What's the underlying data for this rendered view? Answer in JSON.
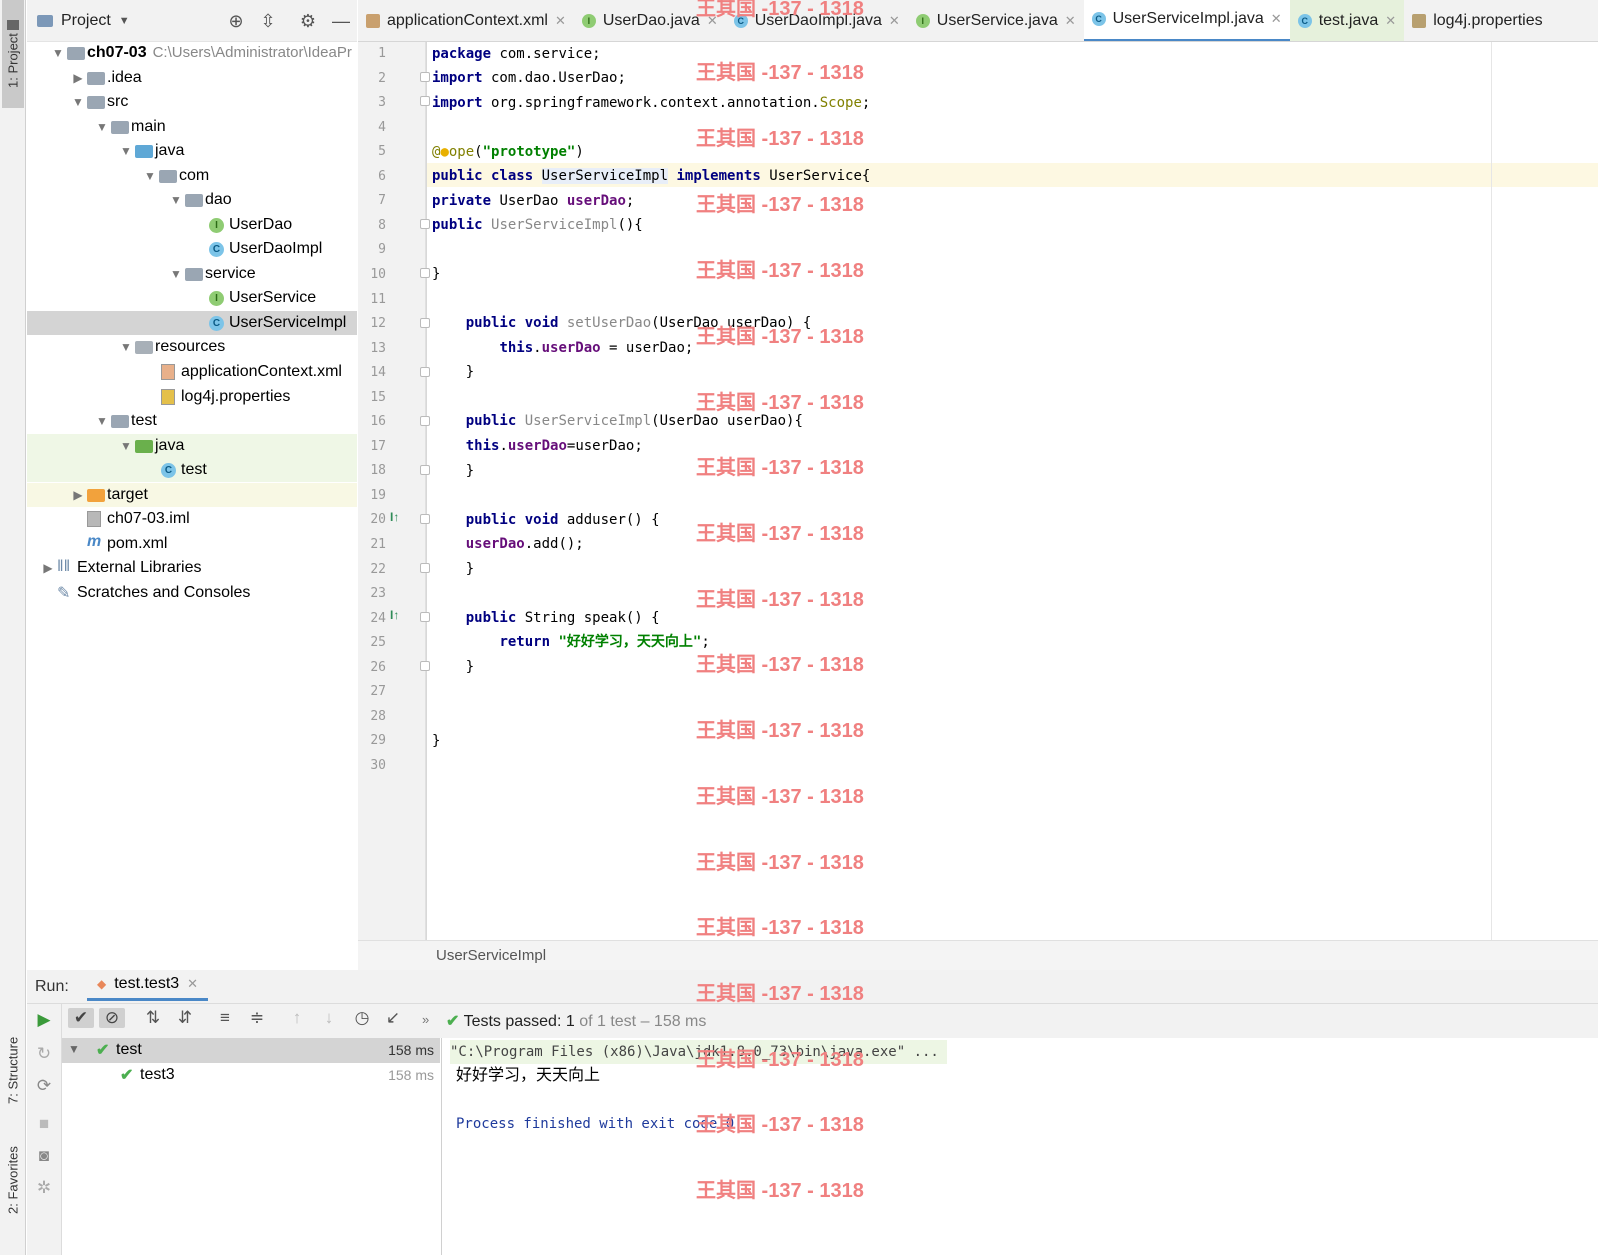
{
  "sidebar": {
    "project_tab": "1: Project",
    "structure_tab": "7: Structure",
    "favorites_tab": "2: Favorites"
  },
  "project": {
    "title": "Project",
    "root_name": "ch07-03",
    "root_path": "C:\\Users\\Administrator\\IdeaPr",
    "tree": [
      {
        "label": "ch07-03",
        "depth": 0,
        "type": "module"
      },
      {
        "label": ".idea",
        "depth": 1,
        "type": "folder"
      },
      {
        "label": "src",
        "depth": 1,
        "type": "folder"
      },
      {
        "label": "main",
        "depth": 2,
        "type": "folder"
      },
      {
        "label": "java",
        "depth": 3,
        "type": "folder-src"
      },
      {
        "label": "com",
        "depth": 4,
        "type": "package"
      },
      {
        "label": "dao",
        "depth": 5,
        "type": "package"
      },
      {
        "label": "UserDao",
        "depth": 6,
        "type": "interface"
      },
      {
        "label": "UserDaoImpl",
        "depth": 6,
        "type": "class"
      },
      {
        "label": "service",
        "depth": 5,
        "type": "package"
      },
      {
        "label": "UserService",
        "depth": 6,
        "type": "interface"
      },
      {
        "label": "UserServiceImpl",
        "depth": 6,
        "type": "class"
      },
      {
        "label": "resources",
        "depth": 3,
        "type": "folder-res"
      },
      {
        "label": "applicationContext.xml",
        "depth": 4,
        "type": "xml"
      },
      {
        "label": "log4j.properties",
        "depth": 4,
        "type": "props"
      },
      {
        "label": "test",
        "depth": 2,
        "type": "folder"
      },
      {
        "label": "java",
        "depth": 3,
        "type": "folder-test"
      },
      {
        "label": "test",
        "depth": 4,
        "type": "test-class"
      },
      {
        "label": "target",
        "depth": 1,
        "type": "folder-orange"
      },
      {
        "label": "ch07-03.iml",
        "depth": 1,
        "type": "iml"
      },
      {
        "label": "pom.xml",
        "depth": 1,
        "type": "pom"
      },
      {
        "label": "External Libraries",
        "depth": 0,
        "type": "libs"
      },
      {
        "label": "Scratches and Consoles",
        "depth": 0,
        "type": "scratch"
      }
    ]
  },
  "tabs": [
    {
      "label": "applicationContext.xml",
      "icon": "xml"
    },
    {
      "label": "UserDao.java",
      "icon": "interface"
    },
    {
      "label": "UserDaoImpl.java",
      "icon": "class"
    },
    {
      "label": "UserService.java",
      "icon": "interface"
    },
    {
      "label": "UserServiceImpl.java",
      "icon": "class",
      "active": true
    },
    {
      "label": "test.java",
      "icon": "test-class"
    },
    {
      "label": "log4j.properties",
      "icon": "props"
    }
  ],
  "editor": {
    "line_numbers": [
      "1",
      "2",
      "3",
      "4",
      "5",
      "6",
      "7",
      "8",
      "9",
      "10",
      "11",
      "12",
      "13",
      "14",
      "15",
      "16",
      "17",
      "18",
      "19",
      "20",
      "21",
      "22",
      "23",
      "24",
      "25",
      "26",
      "27",
      "28",
      "29",
      "30"
    ],
    "breadcrumb": "UserServiceImpl",
    "watermark": "王其国 -137 - 1318"
  },
  "run": {
    "label": "Run:",
    "tab": "test.test3",
    "status_prefix": "Tests passed:",
    "status_count": "1",
    "status_suffix": "of 1 test – 158 ms",
    "tree": [
      {
        "label": "test",
        "time": "158 ms"
      },
      {
        "label": "test3",
        "time": "158 ms"
      }
    ],
    "console": [
      "\"C:\\Program Files (x86)\\Java\\jdk1.8.0_73\\bin\\java.exe\" ...",
      "好好学习，天天向上",
      "Process finished with exit code 0"
    ]
  }
}
